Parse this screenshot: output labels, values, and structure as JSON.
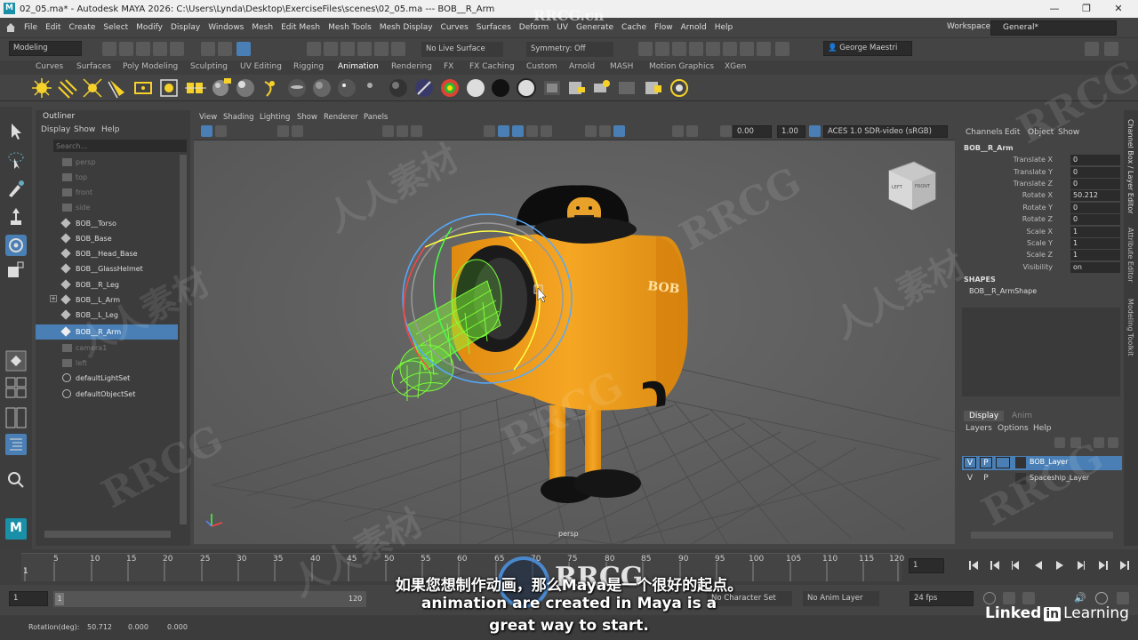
{
  "window": {
    "title": "02_05.ma* - Autodesk MAYA 2026: C:\\Users\\Lynda\\Desktop\\ExerciseFiles\\scenes\\02_05.ma   ---   BOB__R_Arm",
    "minimize": "—",
    "maximize": "❐",
    "close": "✕"
  },
  "menubar": [
    "File",
    "Edit",
    "Create",
    "Select",
    "Modify",
    "Display",
    "Windows",
    "Mesh",
    "Edit Mesh",
    "Mesh Tools",
    "Mesh Display",
    "Curves",
    "Surfaces",
    "Deform",
    "UV",
    "Generate",
    "Cache",
    "Flow",
    "Arnold",
    "Help"
  ],
  "workspace": {
    "label": "Workspace:",
    "value": "General*"
  },
  "statusline": {
    "menuset": "Modeling",
    "live_surface": "No Live Surface",
    "symmetry": "Symmetry: Off",
    "user": "George Maestri"
  },
  "shelf_tabs": [
    "Curves",
    "Surfaces",
    "Poly Modeling",
    "Sculpting",
    "UV Editing",
    "Rigging",
    "Animation",
    "Rendering",
    "FX",
    "FX Caching",
    "Custom",
    "Arnold",
    "MASH",
    "Motion Graphics",
    "XGen"
  ],
  "outliner": {
    "title": "Outliner",
    "menu": [
      "Display",
      "Show",
      "Help"
    ],
    "search_placeholder": "Search...",
    "items": [
      "persp",
      "top",
      "front",
      "side",
      "BOB__Torso",
      "BOB_Base",
      "BOB__Head_Base",
      "BOB__GlassHelmet",
      "BOB__R_Leg",
      "BOB__L_Arm",
      "BOB__L_Leg",
      "BOB__R_Arm",
      "camera1",
      "left",
      "defaultLightSet",
      "defaultObjectSet"
    ],
    "selected": "BOB__R_Arm"
  },
  "viewport": {
    "menu": [
      "View",
      "Shading",
      "Lighting",
      "Show",
      "Renderer",
      "Panels"
    ],
    "exposure": "0.00",
    "gamma": "1.00",
    "colorspace": "ACES 1.0 SDR-video (sRGB)",
    "camera_label": "persp",
    "viewcube_left": "LEFT",
    "viewcube_front": "FRONT",
    "decal": "BOB"
  },
  "channelbox": {
    "menu": [
      "Channels",
      "Edit",
      "Object",
      "Show"
    ],
    "object": "BOB__R_Arm",
    "channels": [
      {
        "name": "Translate X",
        "value": "0"
      },
      {
        "name": "Translate Y",
        "value": "0"
      },
      {
        "name": "Translate Z",
        "value": "0"
      },
      {
        "name": "Rotate X",
        "value": "50.212"
      },
      {
        "name": "Rotate Y",
        "value": "0"
      },
      {
        "name": "Rotate Z",
        "value": "0"
      },
      {
        "name": "Scale X",
        "value": "1"
      },
      {
        "name": "Scale Y",
        "value": "1"
      },
      {
        "name": "Scale Z",
        "value": "1"
      },
      {
        "name": "Visibility",
        "value": "on"
      }
    ],
    "shapes_header": "SHAPES",
    "shape": "BOB__R_ArmShape"
  },
  "sidetabs": [
    "Channel Box / Layer Editor",
    "Attribute Editor",
    "Modeling Toolkit"
  ],
  "layers": {
    "tabs": [
      "Display",
      "Anim"
    ],
    "menu": [
      "Layers",
      "Options",
      "Help"
    ],
    "rows": [
      {
        "v": "V",
        "p": "P",
        "name": "BOB_Layer"
      },
      {
        "v": "V",
        "p": "P",
        "name": "Spaceship_Layer"
      }
    ]
  },
  "timeline": {
    "ticks": [
      "1",
      "5",
      "10",
      "15",
      "20",
      "25",
      "30",
      "35",
      "40",
      "45",
      "50",
      "55",
      "60",
      "65",
      "70",
      "75",
      "80",
      "85",
      "90",
      "95",
      "100",
      "105",
      "110",
      "115",
      "120"
    ],
    "current_frame": "1"
  },
  "range": {
    "start": "1",
    "start_inner": "1",
    "end_inner": "120",
    "char_set": "No Character Set",
    "anim_layer": "No Anim Layer",
    "fps": "24 fps"
  },
  "helpline": {
    "label": "Rotation(deg):",
    "x": "50.712",
    "y": "0.000",
    "z": "0.000"
  },
  "subtitles": {
    "zh": "如果您想制作动画，那么Maya是一个很好的起点。",
    "en1": "animation are created in Maya is a",
    "en2": "great way to start."
  },
  "branding": {
    "linkedin": "Linked",
    "in": "in",
    "learning": "Learning",
    "rrcg": "RRCG",
    "rrcg_cn": "RRCG.cn",
    "watermark": "人人素材"
  },
  "colors": {
    "selection": "#4a7fb5",
    "robot": "#f2a31b",
    "wireframe": "#7dff3a",
    "panel": "#444444"
  }
}
